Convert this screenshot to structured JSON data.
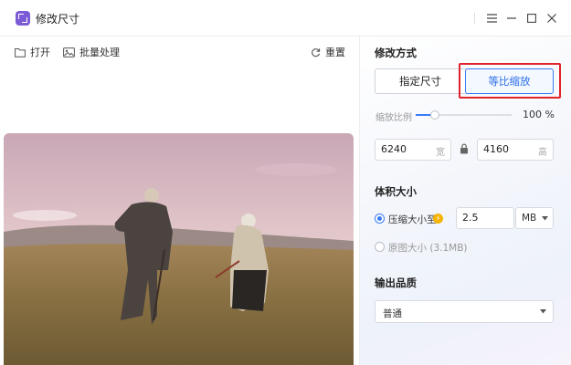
{
  "window": {
    "title": "修改尺寸"
  },
  "toolbar": {
    "open": "打开",
    "batch": "批量处理",
    "reset": "重置"
  },
  "resize_mode": {
    "title": "修改方式",
    "options": [
      "指定尺寸",
      "等比缩放"
    ],
    "selected": "等比缩放"
  },
  "scale": {
    "label": "缩放比例",
    "value": "100 %",
    "fraction": 0.2
  },
  "dimensions": {
    "width": "6240",
    "width_unit": "宽",
    "height": "4160",
    "height_unit": "高"
  },
  "file_size": {
    "title": "体积大小",
    "compress_label": "压缩大小至",
    "compress_value": "2.5",
    "compress_unit": "MB",
    "original_label": "原图大小",
    "original_size": "(3.1MB)"
  },
  "quality": {
    "title": "输出品质",
    "value": "普通"
  },
  "colors": {
    "accent": "#3a7cf6",
    "highlight": "#e0242a",
    "brand": "#7b5bd6"
  }
}
